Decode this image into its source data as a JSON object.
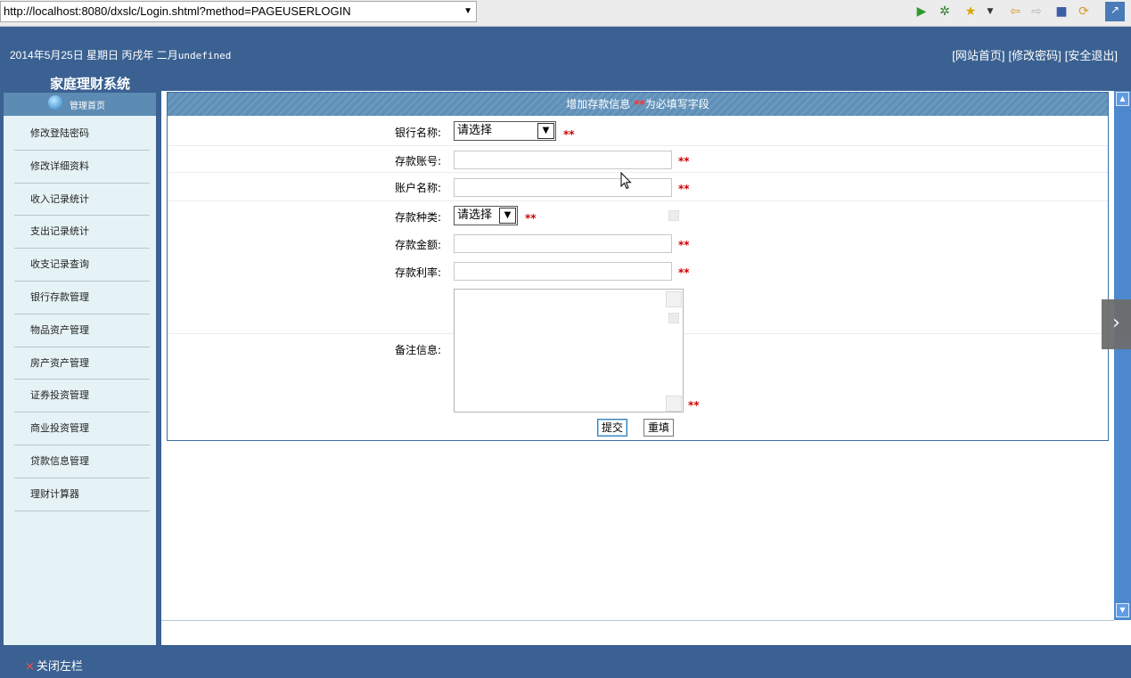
{
  "browser": {
    "url": "http://localhost:8080/dxslc/Login.shtml?method=PAGEUSERLOGIN",
    "icons": [
      "run-icon",
      "debug-icon",
      "favorites-icon",
      "back-icon",
      "forward-icon",
      "stop-icon",
      "refresh-icon",
      "plugin-icon"
    ]
  },
  "header": {
    "date": "2014年5月25日 星期日 丙戌年 二月",
    "date_suffix": "undefined",
    "system_title": "家庭理财系统",
    "links": [
      "[网站首页]",
      "[修改密码]",
      "[安全退出]"
    ]
  },
  "sidebar": {
    "home_label": "管理首页",
    "items": [
      "修改登陆密码",
      "修改详细资料",
      "收入记录统计",
      "支出记录统计",
      "收支记录查询",
      "银行存款管理",
      "物品资产管理",
      "房产资产管理",
      "证券投资管理",
      "商业投资管理",
      "贷款信息管理",
      "理财计算器"
    ]
  },
  "form": {
    "title": "增加存款信息",
    "title_req": "**",
    "title_suffix": "为必填写字段",
    "required_mark": "**",
    "fields": {
      "bank_name": {
        "label": "银行名称:",
        "value": "请选择"
      },
      "account_no": {
        "label": "存款账号:",
        "value": ""
      },
      "account_name": {
        "label": "账户名称:",
        "value": ""
      },
      "deposit_type": {
        "label": "存款种类:",
        "value": "请选择"
      },
      "amount": {
        "label": "存款金额:",
        "value": ""
      },
      "rate": {
        "label": "存款利率:",
        "value": ""
      },
      "remark": {
        "label": "备注信息:",
        "value": ""
      }
    },
    "submit_label": "提交",
    "reset_label": "重填"
  },
  "footer": {
    "close_x": "×",
    "close_label": "关闭左栏"
  },
  "colors": {
    "header_bg": "#3a6192",
    "sidebar_bg": "#e6f3f6",
    "required": "#cc0000",
    "scrollbar": "#4d88cf"
  }
}
